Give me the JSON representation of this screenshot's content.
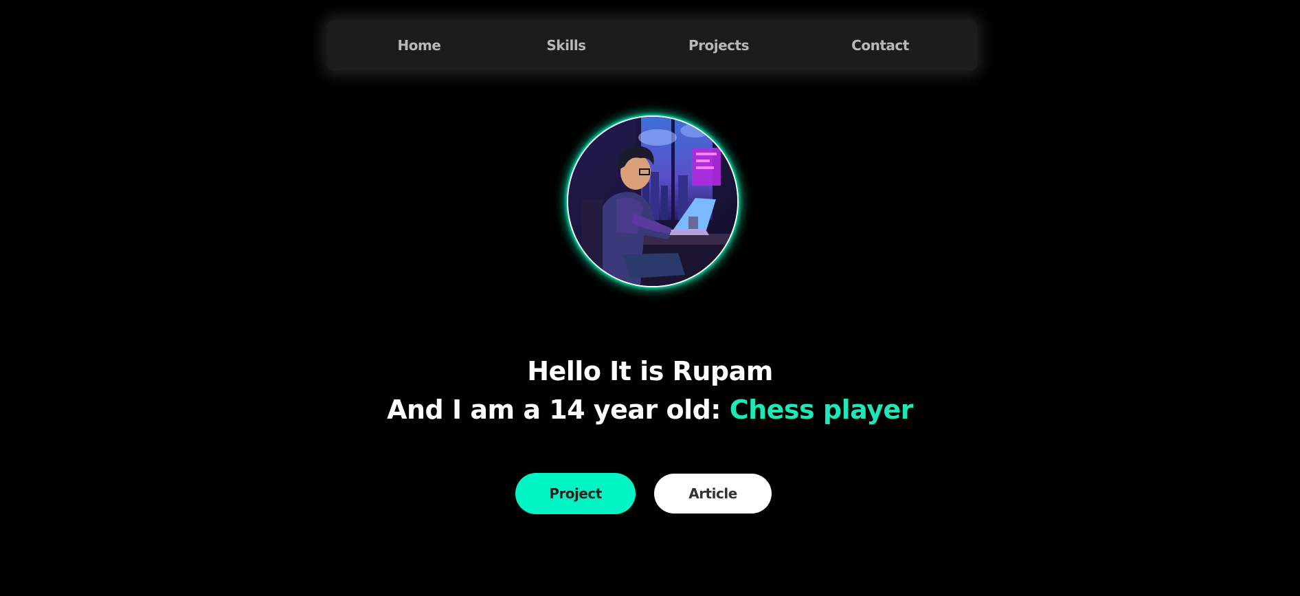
{
  "nav": {
    "items": [
      {
        "label": "Home"
      },
      {
        "label": "Skills"
      },
      {
        "label": "Projects"
      },
      {
        "label": "Contact"
      }
    ]
  },
  "hero": {
    "greeting": "Hello It is Rupam",
    "role_prefix": "And I am a 14 year old: ",
    "role_highlight": "Chess player",
    "avatar_icon": "avatar-illustration"
  },
  "buttons": {
    "project_label": "Project",
    "article_label": "Article"
  },
  "colors": {
    "background": "#000000",
    "navbar": "#1c1c1c",
    "nav_text": "#b8b8b8",
    "accent": "#1de9b6",
    "project_button": "#00f5c4",
    "article_button": "#ffffff"
  }
}
